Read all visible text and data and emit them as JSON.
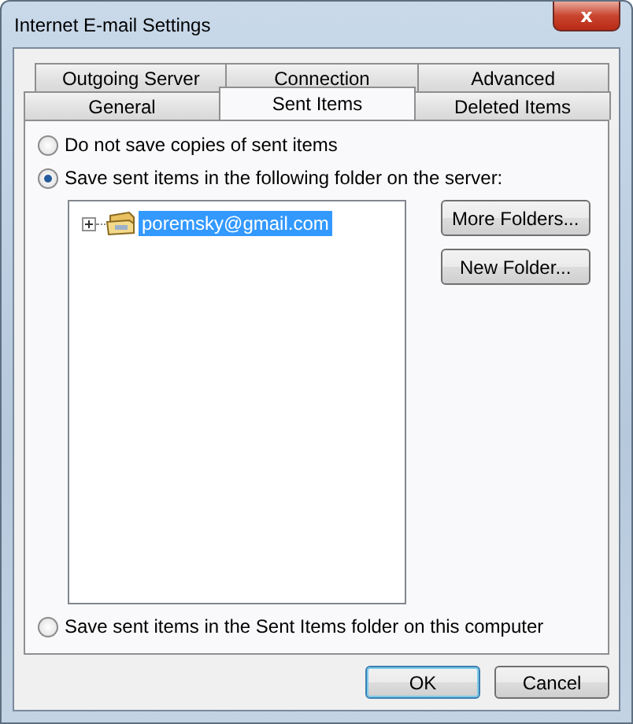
{
  "window": {
    "title": "Internet E-mail Settings",
    "close_label": "x"
  },
  "tab_rows": [
    [
      {
        "label": "Outgoing Server",
        "selected": false
      },
      {
        "label": "Connection",
        "selected": false
      },
      {
        "label": "Advanced",
        "selected": false
      }
    ],
    [
      {
        "label": "General",
        "selected": false
      },
      {
        "label": "Sent Items",
        "selected": true
      },
      {
        "label": "Deleted Items",
        "selected": false
      }
    ]
  ],
  "options": [
    {
      "label": "Do not save copies of sent items",
      "selected": false
    },
    {
      "label": "Save sent items in the following folder on the server:",
      "selected": true
    }
  ],
  "folder_tree": [
    {
      "label": "poremsky@gmail.com",
      "expanded": false,
      "selected": true
    }
  ],
  "folder_buttons": [
    "More Folders...",
    "New Folder..."
  ],
  "local_option": {
    "label": "Save sent items in the Sent Items folder on this computer",
    "selected": false
  },
  "buttons": [
    {
      "label": "OK",
      "default": true
    },
    {
      "label": "Cancel",
      "default": false
    }
  ]
}
